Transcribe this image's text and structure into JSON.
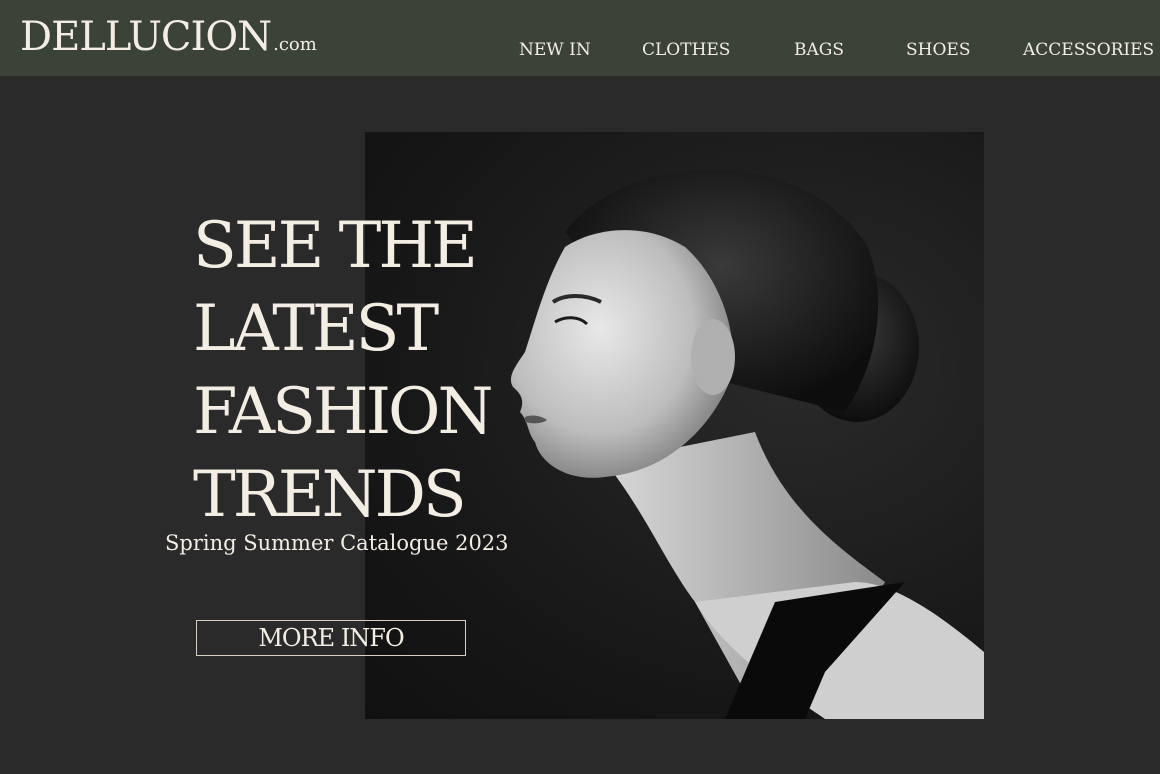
{
  "brand": {
    "name": "DELLUCION",
    "tld": ".com"
  },
  "nav": {
    "items": [
      {
        "label": "NEW IN"
      },
      {
        "label": "CLOTHES"
      },
      {
        "label": "BAGS"
      },
      {
        "label": "SHOES"
      },
      {
        "label": "ACCESSORIES"
      }
    ]
  },
  "hero": {
    "headline_lines": [
      "SEE THE",
      "LATEST",
      "FASHION",
      "TRENDS"
    ],
    "subtitle": "Spring Summer Catalogue 2023",
    "cta_label": "MORE INFO",
    "image_subject": "black and white profile portrait of a woman with hair in a low bun"
  },
  "colors": {
    "header_bg": "#3b4338",
    "page_bg": "#2a2a2a",
    "text": "#f3ede3",
    "button_border": "#d7cfc2"
  }
}
